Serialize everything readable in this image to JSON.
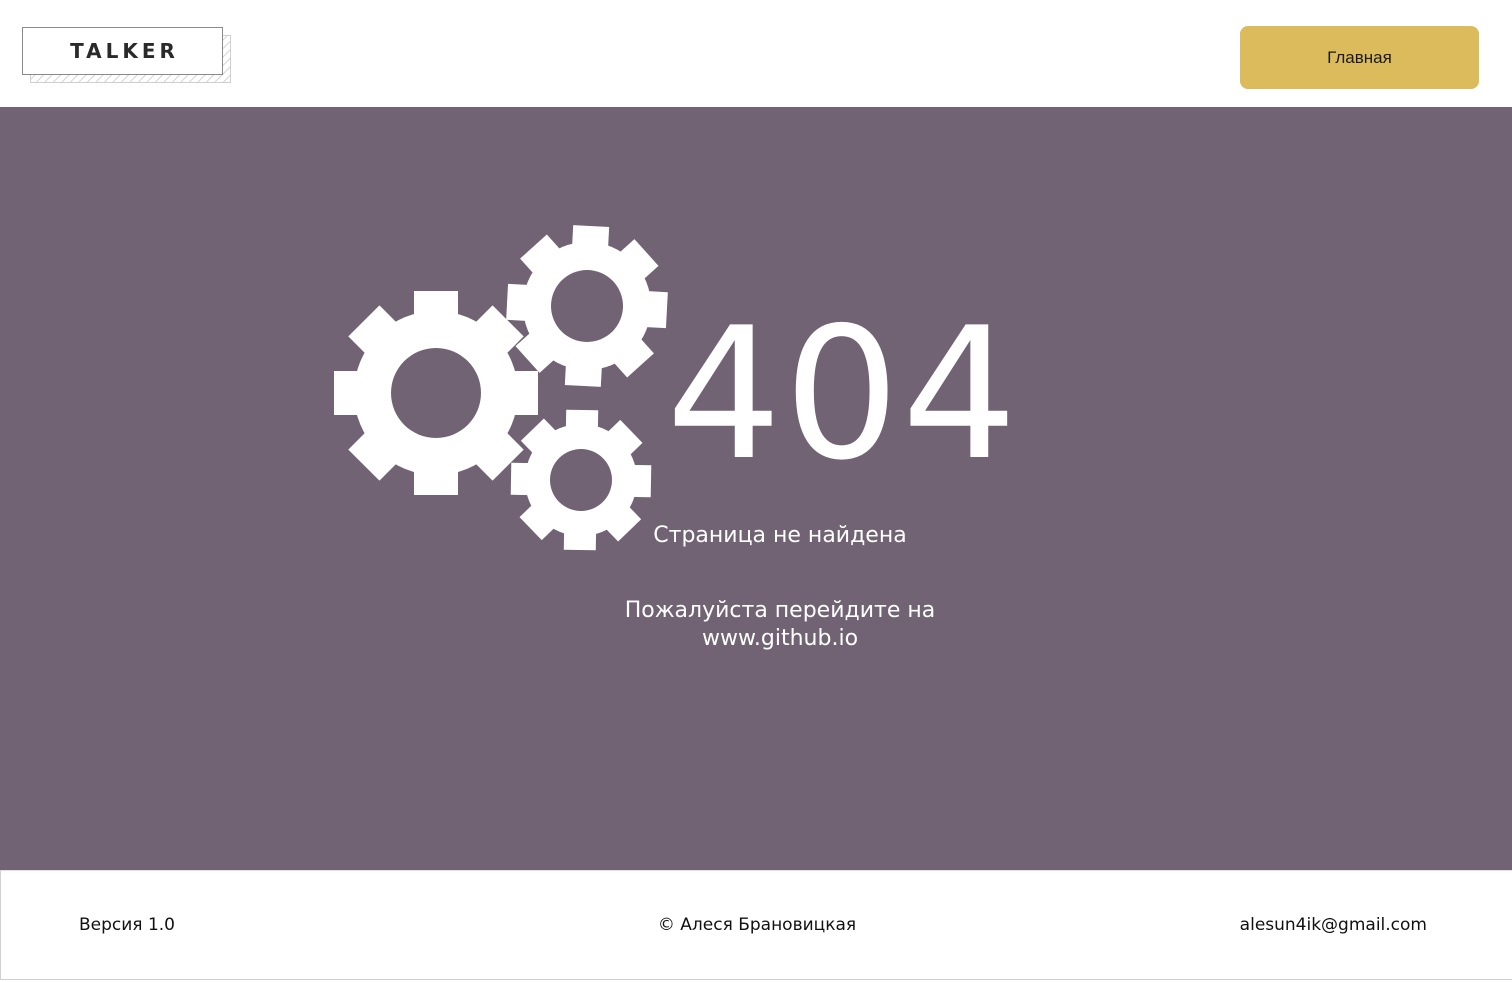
{
  "header": {
    "logo_text": "TALKER",
    "home_button_label": "Главная"
  },
  "main": {
    "background_color": "#716374",
    "icon": "gears-icon",
    "error_code": "404",
    "error_title": "Страница не найдена",
    "hint_line1": "Пожалуйста перейдите на",
    "hint_line2": "www.github.io"
  },
  "footer": {
    "version": "Версия 1.0",
    "copyright": "© Алеся Брановицкая",
    "email": "alesun4ik@gmail.com"
  },
  "colors": {
    "accent": "#dcbb5c",
    "main_bg": "#716374",
    "text_on_main": "#ffffff"
  }
}
